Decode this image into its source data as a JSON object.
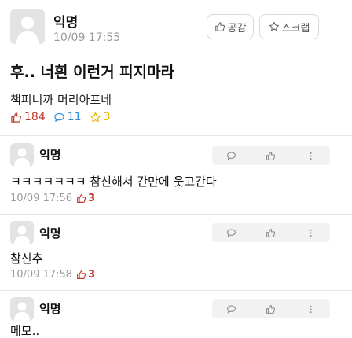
{
  "post": {
    "author": "익명",
    "time": "10/09 17:55",
    "like_button_label": "공감",
    "scrap_button_label": "스크랩",
    "title": "후.. 너흰 이런거 피지마라",
    "body": "책피니까 머리아프네",
    "stats": {
      "likes": "184",
      "comments": "11",
      "scraps": "3"
    }
  },
  "comments": [
    {
      "author": "익명",
      "text": "ㅋㅋㅋㅋㅋㅋㅋ 참신해서 간만에 웃고간다",
      "time": "10/09 17:56",
      "likes": "3"
    },
    {
      "author": "익명",
      "text": "참신추",
      "time": "10/09 17:58",
      "likes": "3"
    },
    {
      "author": "익명",
      "text": "메모..",
      "time": "",
      "likes": ""
    }
  ],
  "colors": {
    "like": "#c0392b",
    "comment": "#2c8fd6",
    "scrap": "#e8b400",
    "muted": "#9a9a9a"
  },
  "icons": [
    "avatar-placeholder",
    "thumbs-up-icon",
    "star-icon",
    "speech-bubble-icon",
    "more-vertical-icon"
  ]
}
